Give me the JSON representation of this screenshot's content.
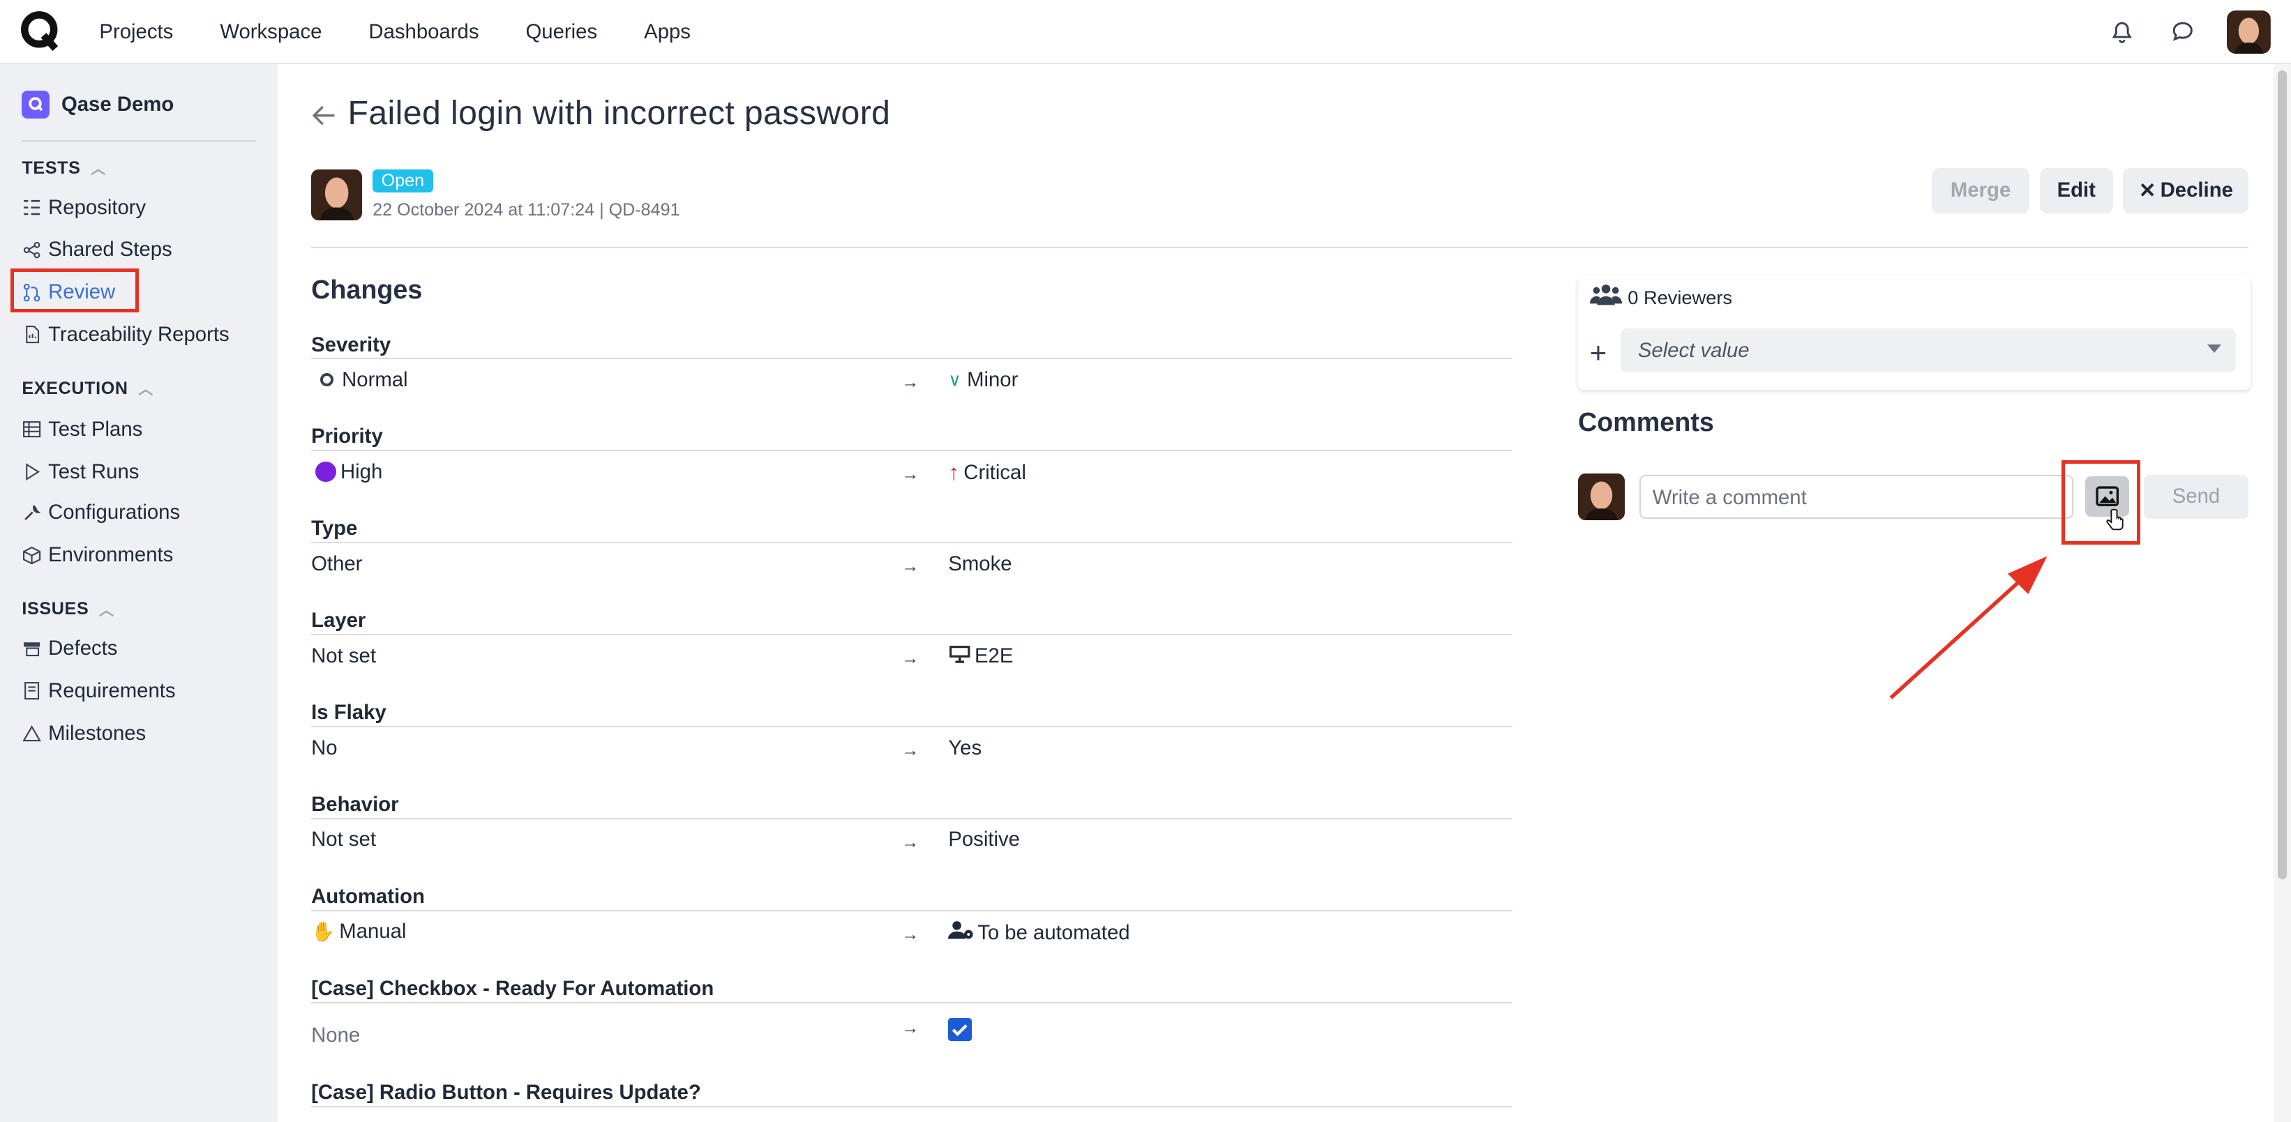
{
  "nav": {
    "items": [
      "Projects",
      "Workspace",
      "Dashboards",
      "Queries",
      "Apps"
    ]
  },
  "sidebar": {
    "project": "Qase Demo",
    "tests_header": "TESTS",
    "tests": [
      "Repository",
      "Shared Steps",
      "Review",
      "Traceability Reports"
    ],
    "execution_header": "EXECUTION",
    "execution": [
      "Test Plans",
      "Test Runs",
      "Configurations",
      "Environments"
    ],
    "issues_header": "ISSUES",
    "issues": [
      "Defects",
      "Requirements",
      "Milestones"
    ],
    "active_item": "Review"
  },
  "page": {
    "title": "Failed login with incorrect password",
    "status": "Open",
    "meta": "22 October 2024 at 11:07:24 | QD-8491",
    "buttons": {
      "merge": "Merge",
      "edit": "Edit",
      "decline": "Decline"
    },
    "changes_title": "Changes",
    "changes": [
      {
        "label": "Severity",
        "old": "Normal",
        "new": "Minor"
      },
      {
        "label": "Priority",
        "old": "High",
        "new": "Critical"
      },
      {
        "label": "Type",
        "old": "Other",
        "new": "Smoke"
      },
      {
        "label": "Layer",
        "old": "Not set",
        "new": "E2E"
      },
      {
        "label": "Is Flaky",
        "old": "No",
        "new": "Yes"
      },
      {
        "label": "Behavior",
        "old": "Not set",
        "new": "Positive"
      },
      {
        "label": "Automation",
        "old": "Manual",
        "new": "To be automated"
      },
      {
        "label": "[Case] Checkbox - Ready For Automation",
        "old": "None",
        "new": ""
      },
      {
        "label": "[Case] Radio Button - Requires Update?",
        "old": "",
        "new": ""
      }
    ],
    "arrow": "→"
  },
  "reviewers": {
    "title": "0 Reviewers",
    "placeholder": "Select value"
  },
  "comments": {
    "title": "Comments",
    "placeholder": "Write a comment",
    "send": "Send"
  },
  "colors": {
    "accent": "#3b6fd4",
    "badge": "#1fc1ea",
    "highlight": "#e53222",
    "priority_high": "#7b1fe0",
    "priority_critical": "#e11d2a"
  },
  "icons": [
    "bell-icon",
    "chat-icon",
    "image-icon",
    "back-arrow-icon",
    "reviewers-icon",
    "plus-icon"
  ]
}
